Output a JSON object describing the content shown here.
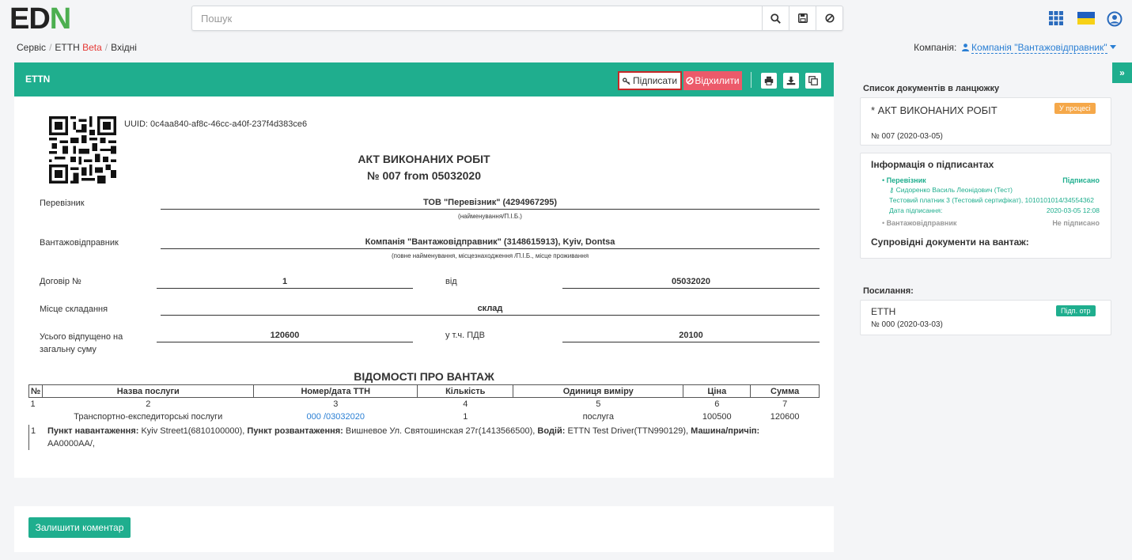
{
  "header": {
    "logo_left": "ED",
    "logo_right": "N",
    "search_placeholder": "Пошук"
  },
  "breadcrumb": {
    "items": [
      "Сервіс",
      "ЕТТН",
      "Вхідні"
    ],
    "beta": "Beta"
  },
  "company": {
    "label": "Компанія:",
    "name": "Компанія \"Вантажовідправник\""
  },
  "document_card": {
    "title": "ETTN",
    "sign_label": "Підписати",
    "reject_label": "Відхилити",
    "uuid": "UUID: 0c4aa840-af8c-46cc-a40f-237f4d383ce6",
    "doc_title": "АКТ ВИКОНАНИХ РОБІТ",
    "doc_number": "№ 007 from 05032020",
    "carrier_label": "Перевізник",
    "carrier_value": "ТОВ \"Перевізник\" (4294967295)",
    "carrier_hint": "(найменування/П.І.Б.)",
    "shipper_label": "Вантажовідправник",
    "shipper_value": "Компанія \"Вантажовідправник\" (3148615913), Kyiv, Dontsa",
    "shipper_hint": "(повне найменування, місцезнаходження /П.І.Б., місце проживання",
    "contract_label": "Договір №",
    "contract_value": "1",
    "from_label": "від",
    "from_value": "05032020",
    "place_label": "Місце складання",
    "place_value": "склад",
    "total_label": "Усього відпущено на загальну суму",
    "total_value": "120600",
    "vat_label": "у т.ч. ПДВ",
    "vat_value": "20100"
  },
  "cargo": {
    "section_title": "ВІДОМОСТІ ПРО ВАНТАЖ",
    "headers": [
      "№",
      "Назва послуги",
      "Номер/дата ТТН",
      "Кількість",
      "Одиниця виміру",
      "Ціна",
      "Сумма"
    ],
    "index_row": [
      "1",
      "2",
      "3",
      "4",
      "5",
      "6",
      "7"
    ],
    "row": {
      "service": "Транспортно-експедиторські послуги",
      "ttn": "000 /03032020",
      "qty": "1",
      "unit": "послуга",
      "price": "100500",
      "sum": "120600"
    },
    "route": {
      "num": "1",
      "load_label": "Пункт навантаження:",
      "load_value": "Kyiv Street1(6810100000),",
      "unload_label": "Пункт розвантаження:",
      "unload_value": "Вишневое Ул. Святошинская 27г(1413566500),",
      "driver_label": "Водій:",
      "driver_value": "ETTN Test Driver(TTN990129),",
      "vehicle_label": "Машина/причіп:",
      "vehicle_value": "AA0000AA/,"
    }
  },
  "comment_button": "Залишити коментар",
  "sidebar": {
    "chain_title": "Список документів в ланцюжку",
    "chain_doc": "* АКТ ВИКОНАНИХ РОБІТ",
    "chain_status": "У процесі",
    "chain_number": "№ 007 (2020-03-05)",
    "signers_title": "Інформація о підписантах",
    "signer1_role": "Перевізник",
    "signer1_status": "Підписано",
    "signer1_name": "Сидоренко Василь Леонідович (Тест)",
    "signer1_cert": "Тестовий платник 3 (Тестовий сертифікат), 1010101014/34554362",
    "signer1_date_label": "Дата підписання:",
    "signer1_date": "2020-03-05 12:08",
    "signer2_role": "Вантажовідправник",
    "signer2_status": "Не підписано",
    "accompanying_title": "Супровідні документи на вантаж:",
    "links_title": "Посилання:",
    "link_doc": "ЕТТН",
    "link_status": "Підп. отр",
    "link_number": "№ 000 (2020-03-03)"
  },
  "colors": {
    "brand": "#1fae8e",
    "reject": "#ec5a6a",
    "in_process": "#f5a84a",
    "link": "#2a7fd4"
  }
}
